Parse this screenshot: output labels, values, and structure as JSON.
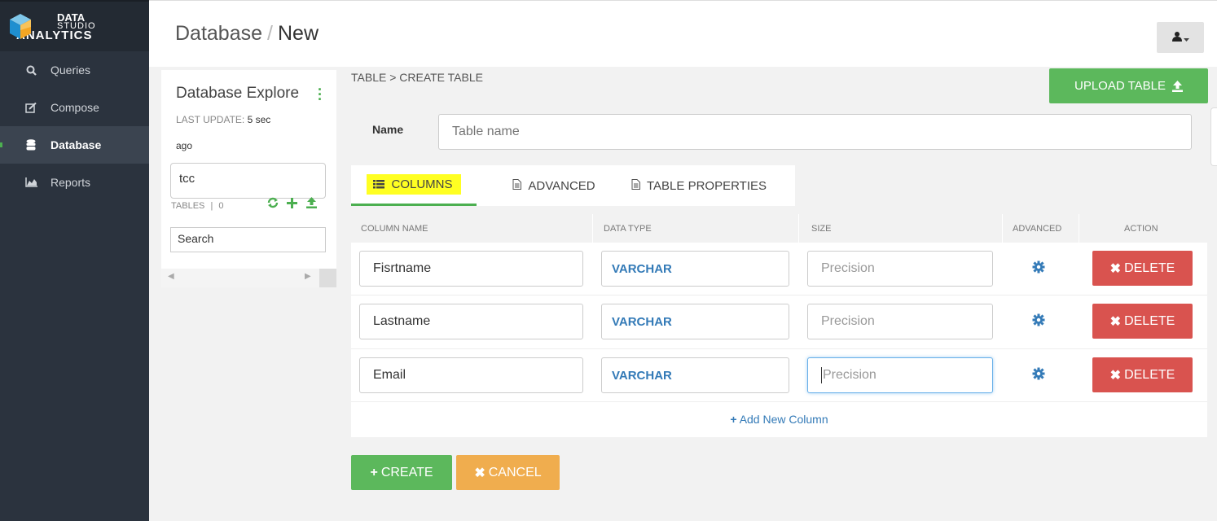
{
  "brand": {
    "line1": "DATA",
    "line2": "STUDIO",
    "line3": "ANALYTICS"
  },
  "sidebar": {
    "items": [
      {
        "label": "Queries",
        "icon": "search-icon"
      },
      {
        "label": "Compose",
        "icon": "edit-icon"
      },
      {
        "label": "Database",
        "icon": "database-icon",
        "active": true
      },
      {
        "label": "Reports",
        "icon": "area-chart-icon"
      }
    ]
  },
  "header": {
    "crumb_root": "Database",
    "separator": "/",
    "crumb_current": "New",
    "user_icon": "user-icon"
  },
  "explorer": {
    "title": "Database Explore",
    "last_update_label": "LAST UPDATE:",
    "last_update_value": "5 sec",
    "last_update_suffix": "ago",
    "database": "tcc",
    "tables_label": "TABLES",
    "tables_sep": "|",
    "tables_count": "0",
    "search_placeholder": "Search"
  },
  "main": {
    "breadcrumb": "TABLE > CREATE TABLE",
    "upload_label": "UPLOAD TABLE",
    "name_label": "Name",
    "name_placeholder": "Table name",
    "tabs": [
      {
        "label": "COLUMNS",
        "active": true
      },
      {
        "label": "ADVANCED"
      },
      {
        "label": "TABLE PROPERTIES"
      }
    ],
    "columns_headers": [
      "COLUMN NAME",
      "DATA TYPE",
      "SIZE",
      "ADVANCED",
      "ACTION"
    ],
    "rows": [
      {
        "name": "Fisrtname",
        "type": "VARCHAR",
        "size_placeholder": "Precision",
        "action": "DELETE"
      },
      {
        "name": "Lastname",
        "type": "VARCHAR",
        "size_placeholder": "Precision",
        "action": "DELETE"
      },
      {
        "name": "Email",
        "type": "VARCHAR",
        "size_placeholder": "Precision",
        "action": "DELETE",
        "focused": true
      }
    ],
    "add_column_label": "Add New Column",
    "create_label": "CREATE",
    "cancel_label": "CANCEL"
  },
  "colors": {
    "sidebar_bg": "#2b333e",
    "accent_green": "#5cb85c",
    "danger_red": "#d9534f",
    "warning_orange": "#f0ad4e",
    "link_blue": "#337ab7",
    "highlight_yellow": "#ffff22"
  }
}
